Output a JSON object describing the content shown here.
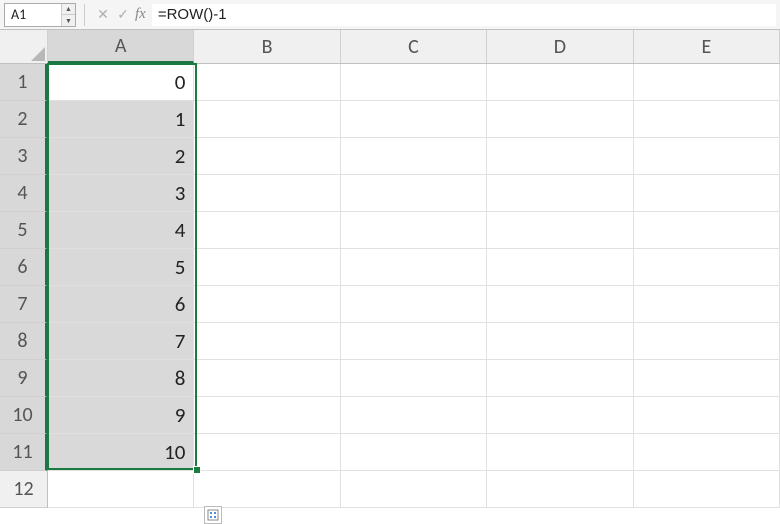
{
  "formula_bar": {
    "name_box": "A1",
    "fx_label": "fx",
    "formula": "=ROW()-1"
  },
  "columns": [
    "A",
    "B",
    "C",
    "D",
    "E"
  ],
  "rows": [
    1,
    2,
    3,
    4,
    5,
    6,
    7,
    8,
    9,
    10,
    11,
    12
  ],
  "selected_column": "A",
  "selected_rows": [
    1,
    2,
    3,
    4,
    5,
    6,
    7,
    8,
    9,
    10,
    11
  ],
  "active_cell": {
    "row": 1,
    "col": "A"
  },
  "cells": {
    "A1": "0",
    "A2": "1",
    "A3": "2",
    "A4": "3",
    "A5": "4",
    "A6": "5",
    "A7": "6",
    "A8": "7",
    "A9": "8",
    "A10": "9",
    "A11": "10"
  },
  "colors": {
    "selection_border": "#1a7a3f"
  }
}
